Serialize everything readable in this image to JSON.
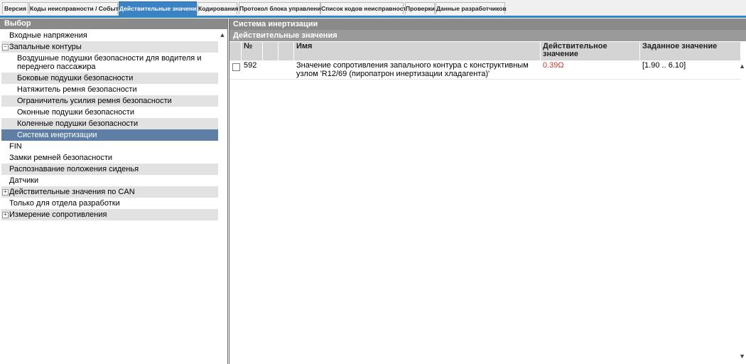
{
  "tabs": [
    {
      "label": "Версия",
      "active": false
    },
    {
      "label": "Коды неисправности / События",
      "active": false
    },
    {
      "label": "Действительные значения",
      "active": true
    },
    {
      "label": "Кодирования",
      "active": false
    },
    {
      "label": "Протокол блока управления",
      "active": false
    },
    {
      "label": "Список кодов неисправности",
      "active": false
    },
    {
      "label": "Проверки",
      "active": false
    },
    {
      "label": "Данные разработчиков",
      "active": false
    }
  ],
  "left_panel": {
    "header": "Выбор",
    "tree": [
      {
        "label": "Входные напряжения"
      },
      {
        "label": "Запальные контуры",
        "expander": "−"
      },
      {
        "label": "Воздушные подушки безопасности для водителя и переднего пассажира"
      },
      {
        "label": "Боковые подушки безопасности"
      },
      {
        "label": "Натяжитель ремня безопасности"
      },
      {
        "label": "Ограничитель усилия ремня безопасности"
      },
      {
        "label": "Оконные подушки безопасности"
      },
      {
        "label": "Коленные подушки безопасности"
      },
      {
        "label": "Система инертизации"
      },
      {
        "label": "FIN"
      },
      {
        "label": "Замки ремней безопасности"
      },
      {
        "label": "Распознавание положения сиденья"
      },
      {
        "label": "Датчики"
      },
      {
        "label": "Действительные значения по CAN",
        "expander": "+"
      },
      {
        "label": "Только для отдела разработки"
      },
      {
        "label": "Измерение сопротивления",
        "expander": "+"
      }
    ]
  },
  "right_panel": {
    "title": "Система инертизации",
    "subtitle": "Действительные значения",
    "columns": {
      "num": "№",
      "name": "Имя",
      "actual": "Действительное значение",
      "setpoint": "Заданное значение"
    },
    "rows": [
      {
        "num": "592",
        "name": "Значение сопротивления запального контура с конструктивным узлом 'R12/69 (пиропатрон инертизации хладагента)'",
        "actual": "0.39Ω",
        "setpoint": "[1.90 .. 6.10]"
      }
    ]
  },
  "icons": {
    "scroll_up": "▲",
    "scroll_down": "▼"
  },
  "colors": {
    "tab_active": "#3a82c4",
    "selected_item": "#5e7fa3",
    "out_of_range_value": "#c0392b",
    "panel_header": "#8a8a8a"
  }
}
